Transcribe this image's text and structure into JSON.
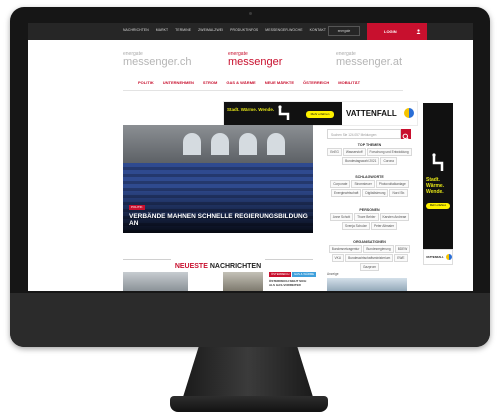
{
  "topnav": {
    "links": [
      "NACHRICHTEN",
      "MARKT",
      "TERMINE",
      "ZWEIMALZWEI",
      "PRODUKTINFOS",
      "MESSENGER-WOCHE",
      "KONTAKT"
    ],
    "partner_logo": "energate",
    "login_label": "LOGIN"
  },
  "brands": {
    "left": {
      "small": "energate",
      "big": "messenger.ch"
    },
    "center": {
      "small": "energate",
      "big": "messenger"
    },
    "right": {
      "small": "energate",
      "big": "messenger.at"
    }
  },
  "catnav": [
    "POLITIK",
    "UNTERNEHMEN",
    "STROM",
    "GAS & WÄRME",
    "NEUE MÄRKTE",
    "ÖSTERREICH",
    "MOBILITÄT"
  ],
  "banner": {
    "slogan": "Stadt. Wärme. Wende.",
    "cta": "Mehr erfahren",
    "brand": "VATTENFALL"
  },
  "hero": {
    "tag": "POLITIK",
    "headline": "VERBÄNDE MAHNEN SCHNELLE REGIERUNGSBILDUNG AN"
  },
  "sidebar": {
    "search_placeholder": "Suchen Sie 124.057 Meldungen",
    "top_topics_title": "TOP THEMEN",
    "top_topics": [
      "EnEG",
      "Wasserstoff",
      "Forschung und Entwicklung",
      "Bundestagswahl 2021",
      "Corona"
    ],
    "keywords_title": "SCHLAGWORTE",
    "keywords": [
      "Corporate",
      "Stromsteuer",
      "Photovoltaikanlage",
      "Energiewirtschaft",
      "Digitalisierung",
      "Nord Str."
    ],
    "persons_title": "PERSONEN",
    "persons": [
      "Anne Schott",
      "Thore Behler",
      "Karsten Andreae",
      "Svenja Schulze",
      "Peter Altmaier"
    ],
    "orgs_title": "ORGANISATIONEN",
    "orgs": [
      "Bundesnetzagentur",
      "Bundesregierung",
      "BDEW",
      "VKU",
      "Bundeswirtschaftsministerium",
      "EWE",
      "Gazprom"
    ]
  },
  "skyscraper": {
    "slogan": "Stadt. Wärme. Wende.",
    "cta": "Mehr erfahren",
    "brand": "VATTENFALL"
  },
  "news": {
    "title_red": "NEUESTE",
    "title_dark": "NACHRICHTEN",
    "pill_red": "ÖSTERREICH",
    "pill_blue": "GAS & WÄRME",
    "snippet": "ÖSTERREICH SIEHT SICH ALS GAS-VORREITER",
    "side_label": "Anzeige"
  },
  "colors": {
    "accent": "#c8102e",
    "dark_nav": "#262626",
    "ad_yellow": "#e6e617"
  }
}
